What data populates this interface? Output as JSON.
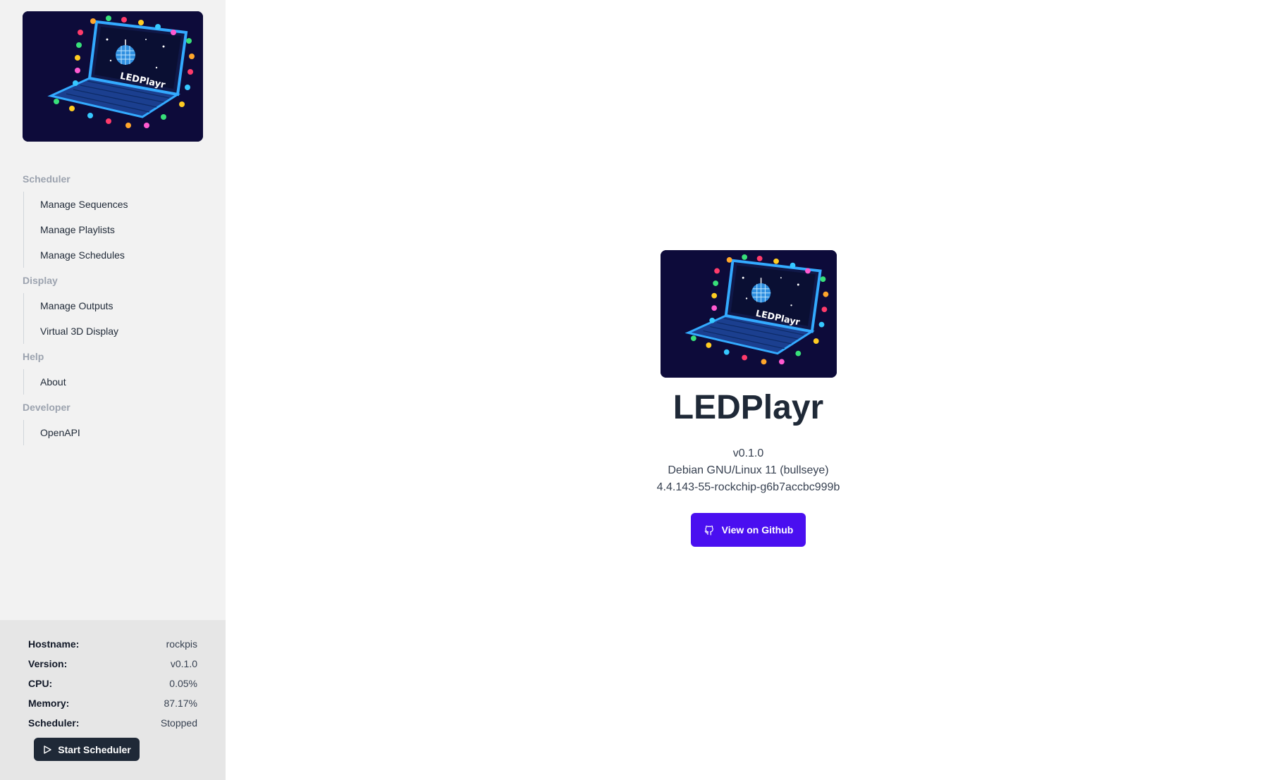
{
  "app": {
    "logo_text": "LEDPlayr"
  },
  "sidebar": {
    "sections": [
      {
        "title": "Scheduler",
        "items": [
          {
            "label": "Manage Sequences"
          },
          {
            "label": "Manage Playlists"
          },
          {
            "label": "Manage Schedules"
          }
        ]
      },
      {
        "title": "Display",
        "items": [
          {
            "label": "Manage Outputs"
          },
          {
            "label": "Virtual 3D Display"
          }
        ]
      },
      {
        "title": "Help",
        "items": [
          {
            "label": "About"
          }
        ]
      },
      {
        "title": "Developer",
        "items": [
          {
            "label": "OpenAPI"
          }
        ]
      }
    ]
  },
  "status": {
    "rows": [
      {
        "label": "Hostname:",
        "value": "rockpis"
      },
      {
        "label": "Version:",
        "value": "v0.1.0"
      },
      {
        "label": "CPU:",
        "value": "0.05%"
      },
      {
        "label": "Memory:",
        "value": "87.17%"
      },
      {
        "label": "Scheduler:",
        "value": "Stopped"
      }
    ],
    "start_button": {
      "label": "Start Scheduler",
      "icon": "play-icon"
    }
  },
  "main": {
    "title": "LEDPlayr",
    "version": "v0.1.0",
    "os": "Debian GNU/Linux 11 (bullseye)",
    "kernel": "4.4.143-55-rockchip-g6b7accbc999b",
    "github_button": {
      "label": "View on Github",
      "icon": "github-icon"
    }
  },
  "colors": {
    "sidebar_bg": "#f2f2f2",
    "status_bg": "#e6e6e6",
    "primary_button": "#4a0ff0",
    "dark_button": "#1f2937",
    "logo_bg": "#0d0b3a"
  }
}
